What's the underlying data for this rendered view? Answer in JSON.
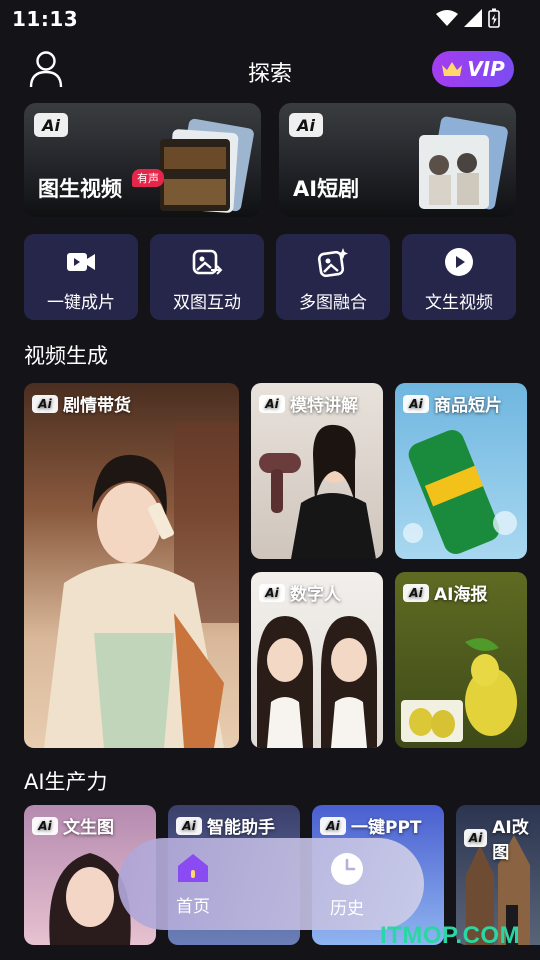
{
  "status": {
    "time": "11:13"
  },
  "header": {
    "title": "探索",
    "vip_label": "VIP"
  },
  "feature_cards": [
    {
      "label": "图生视频",
      "badge": "Ai",
      "tag": "有声"
    },
    {
      "label": "AI短剧",
      "badge": "Ai"
    }
  ],
  "tools": [
    {
      "label": "一键成片",
      "icon": "video-camera-icon"
    },
    {
      "label": "双图互动",
      "icon": "dual-image-icon"
    },
    {
      "label": "多图融合",
      "icon": "multi-image-icon"
    },
    {
      "label": "文生视频",
      "icon": "play-circle-icon"
    }
  ],
  "video_section": {
    "title": "视频生成",
    "tiles": [
      {
        "label": "剧情带货"
      },
      {
        "label": "模特讲解"
      },
      {
        "label": "商品短片"
      },
      {
        "label": "数字人"
      },
      {
        "label": "AI海报"
      }
    ]
  },
  "productivity_section": {
    "title": "AI生产力",
    "tiles": [
      {
        "label": "文生图"
      },
      {
        "label": "智能助手"
      },
      {
        "label": "一键PPT"
      },
      {
        "label": "AI改图"
      }
    ]
  },
  "nav": {
    "home": "首页",
    "history": "历史"
  },
  "watermark": "ITMOP.COM",
  "colors": {
    "accent": "#8a4cf2",
    "tool_bg": "#25264a",
    "watermark": "#2bd6a5"
  }
}
